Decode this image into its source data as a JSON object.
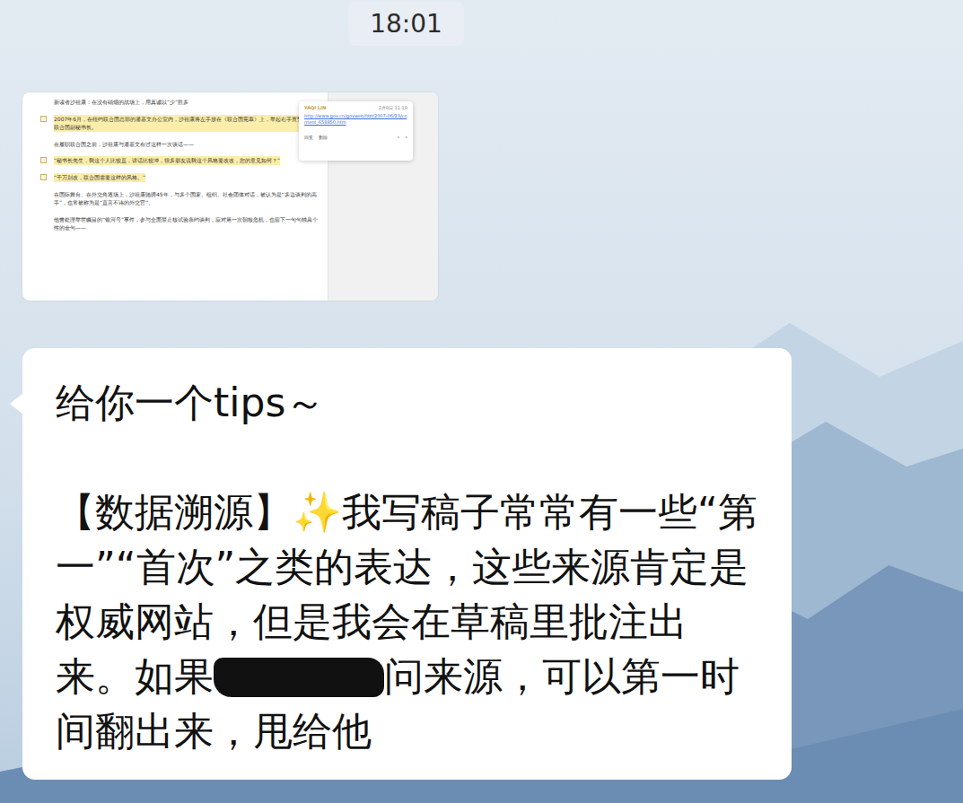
{
  "timestamp": "18:01",
  "image_message": {
    "document": {
      "paragraphs": [
        {
          "text": "新读者沙祖康：在没有硝烟的战场上，用真诚以“少”胜多",
          "highlighted": false
        },
        {
          "text": "2007年6月，在纽约联合国总部的潘基文办公室内，沙祖康将左手放在《联合国宪章》上，举起右手宣誓就职联合国副秘书长。",
          "highlighted": true
        },
        {
          "text": "在履职联合国之前，沙祖康与潘基文有过这样一次谈话——",
          "highlighted": false
        },
        {
          "text": "“秘书长先生，我这个人比较直，讲话比较冲，很多朋友说我这个风格要改改，您的意见如何？”",
          "highlighted": true
        },
        {
          "text": "“千万别改，联合国需要这样的风格。”",
          "highlighted": true
        },
        {
          "text": "在国际舞台、在外交角逐场上，沙祖康驰骋45年，与多个国家、组织、社会团体对话，被认为是“多边谈判的高手”，也常被称为是“直言不讳的外交官”。",
          "highlighted": false
        },
        {
          "text": "他曾处理举世瞩目的“银河号”事件，参与全面禁止核试验条约谈判，应对第一次朝核危机，也留下一句句独具个性的金句——",
          "highlighted": false
        }
      ]
    },
    "comment": {
      "author": "YAQI LIN",
      "date": "2月9日 11:19",
      "link": "http://www.gov.cn/govweb/fzzl/2007-06/23/content_658850.htm",
      "actions": [
        "回复",
        "删除"
      ],
      "nav": [
        "‹",
        "›"
      ]
    }
  },
  "text_message": {
    "greeting": "给你一个tips～",
    "segments": [
      {
        "kind": "text",
        "text": "【数据溯源】✨我写稿子常常有一些“第一”“首次”之类的表达，这些来源肯定是权威网站，但是我会在草稿里批注出来。如果"
      },
      {
        "kind": "redaction",
        "text": ""
      },
      {
        "kind": "text",
        "text": "问来源，可以第一时间翻出来，甩给他"
      }
    ]
  }
}
